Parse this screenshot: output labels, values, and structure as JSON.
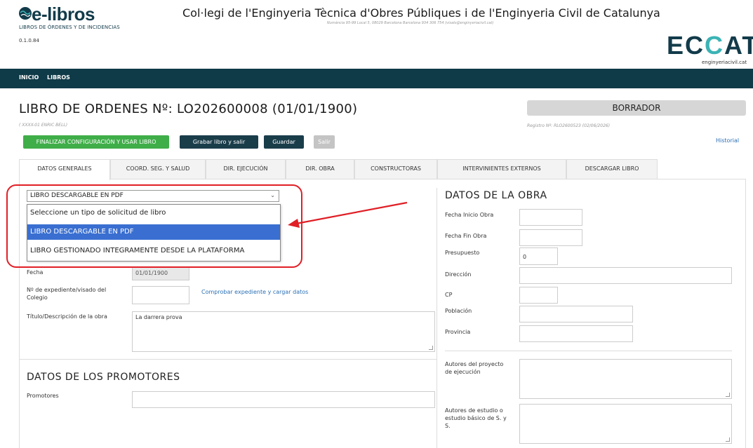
{
  "brand": {
    "logo": "e-libros",
    "subtitle": "LIBROS DE ÓRDENES Y DE INCIDENCIAS",
    "version": "0.1.0.84",
    "college": "Col·legi de l'Enginyeria Tècnica d'Obres Públiques i de l'Enginyeria Civil de Catalunya",
    "college_address": "Numància 95-99 Local 5, 08029 Barcelona Barcelona     934 306 754 (visats@enginyeriacivil.cat)",
    "eccat_logo": "ECCAT",
    "eccat_url": "enginyeriacivil.cat",
    "colors": {
      "primary": "#0f3a48",
      "accent": "#3cb3b5",
      "green": "#3fae49",
      "link": "#2a6fb5",
      "highlight": "#e01f26"
    }
  },
  "nav": {
    "items": [
      "INICIO",
      "LIBROS"
    ]
  },
  "header": {
    "title": "LIBRO DE ORDENES Nº: LO202600008 (01/01/1900)",
    "author": "( XXXX-01 ENRIC BELL)",
    "status": "BORRADOR",
    "registro": "Registro Nº: RLO2600523 (02/06/2026)",
    "historial": "Historial"
  },
  "actions": {
    "finalize": "FINALIZAR CONFIGURACIÓN Y USAR LIBRO",
    "save_exit": "Grabar libro y salir",
    "save": "Guardar",
    "exit": "Salir"
  },
  "tabs": [
    {
      "label": "DATOS GENERALES",
      "active": true
    },
    {
      "label": "COORD. SEG. Y SALUD",
      "active": false
    },
    {
      "label": "DIR. EJECUCIÓN",
      "active": false
    },
    {
      "label": "DIR. OBRA",
      "active": false
    },
    {
      "label": "CONSTRUCTORAS",
      "active": false
    },
    {
      "label": "INTERVINIENTES EXTERNOS",
      "active": false
    },
    {
      "label": "DESCARGAR LIBRO",
      "active": false
    }
  ],
  "left": {
    "book_type": {
      "selected": "LIBRO DESCARGABLE EN PDF",
      "options": [
        "Seleccione un tipo de solicitud de libro",
        "LIBRO DESCARGABLE EN PDF",
        "LIBRO GESTIONADO INTEGRAMENTE DESDE LA PLATAFORMA"
      ]
    },
    "fecha_label": "Fecha",
    "fecha_value": "01/01/1900",
    "expediente_label": "Nº de expediente/visado del Colegio",
    "expediente_value": "",
    "check_link": "Comprobar expediente y cargar datos",
    "titulo_label": "Título/Descripción de la obra",
    "titulo_value": "La darrera prova",
    "promotores_section": "DATOS DE LOS PROMOTORES",
    "promotores_label": "Promotores",
    "promotores_value": ""
  },
  "right": {
    "section": "DATOS DE LA OBRA",
    "fecha_inicio_label": "Fecha Inicio Obra",
    "fecha_fin_label": "Fecha Fin Obra",
    "presupuesto_label": "Presupuesto",
    "presupuesto_value": "0",
    "direccion_label": "Dirección",
    "cp_label": "CP",
    "poblacion_label": "Población",
    "provincia_label": "Provincia",
    "autores_proyecto_label": "Autores del proyecto de ejecución",
    "autores_estudio_label": "Autores de estudio o estudio básico de S. y S."
  }
}
